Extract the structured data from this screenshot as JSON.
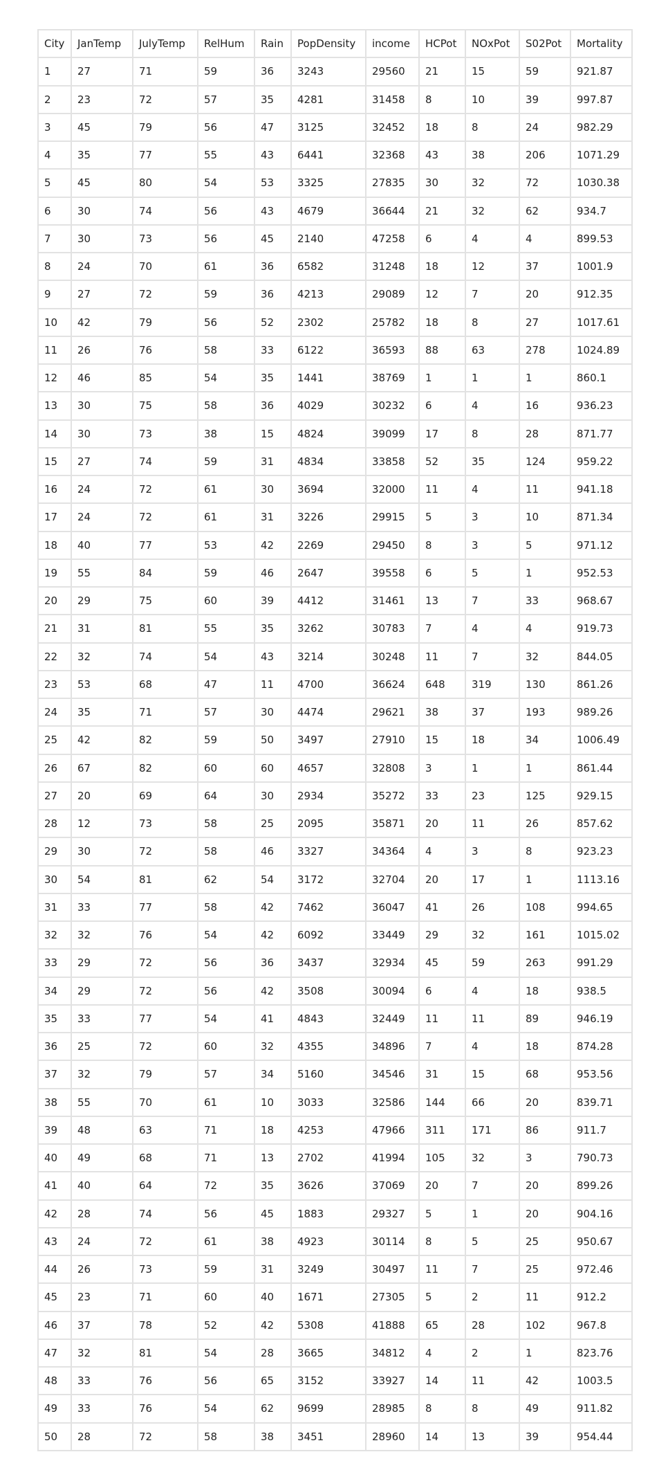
{
  "table": {
    "columns": [
      "City",
      "JanTemp",
      "JulyTemp",
      "RelHum",
      "Rain",
      "PopDensity",
      "income",
      "HCPot",
      "NOxPot",
      "S02Pot",
      "Mortality"
    ],
    "rows": [
      [
        "1",
        "27",
        "71",
        "59",
        "36",
        "3243",
        "29560",
        "21",
        "15",
        "59",
        "921.87"
      ],
      [
        "2",
        "23",
        "72",
        "57",
        "35",
        "4281",
        "31458",
        "8",
        "10",
        "39",
        "997.87"
      ],
      [
        "3",
        "45",
        "79",
        "56",
        "47",
        "3125",
        "32452",
        "18",
        "8",
        "24",
        "982.29"
      ],
      [
        "4",
        "35",
        "77",
        "55",
        "43",
        "6441",
        "32368",
        "43",
        "38",
        "206",
        "1071.29"
      ],
      [
        "5",
        "45",
        "80",
        "54",
        "53",
        "3325",
        "27835",
        "30",
        "32",
        "72",
        "1030.38"
      ],
      [
        "6",
        "30",
        "74",
        "56",
        "43",
        "4679",
        "36644",
        "21",
        "32",
        "62",
        "934.7"
      ],
      [
        "7",
        "30",
        "73",
        "56",
        "45",
        "2140",
        "47258",
        "6",
        "4",
        "4",
        "899.53"
      ],
      [
        "8",
        "24",
        "70",
        "61",
        "36",
        "6582",
        "31248",
        "18",
        "12",
        "37",
        "1001.9"
      ],
      [
        "9",
        "27",
        "72",
        "59",
        "36",
        "4213",
        "29089",
        "12",
        "7",
        "20",
        "912.35"
      ],
      [
        "10",
        "42",
        "79",
        "56",
        "52",
        "2302",
        "25782",
        "18",
        "8",
        "27",
        "1017.61"
      ],
      [
        "11",
        "26",
        "76",
        "58",
        "33",
        "6122",
        "36593",
        "88",
        "63",
        "278",
        "1024.89"
      ],
      [
        "12",
        "46",
        "85",
        "54",
        "35",
        "1441",
        "38769",
        "1",
        "1",
        "1",
        "860.1"
      ],
      [
        "13",
        "30",
        "75",
        "58",
        "36",
        "4029",
        "30232",
        "6",
        "4",
        "16",
        "936.23"
      ],
      [
        "14",
        "30",
        "73",
        "38",
        "15",
        "4824",
        "39099",
        "17",
        "8",
        "28",
        "871.77"
      ],
      [
        "15",
        "27",
        "74",
        "59",
        "31",
        "4834",
        "33858",
        "52",
        "35",
        "124",
        "959.22"
      ],
      [
        "16",
        "24",
        "72",
        "61",
        "30",
        "3694",
        "32000",
        "11",
        "4",
        "11",
        "941.18"
      ],
      [
        "17",
        "24",
        "72",
        "61",
        "31",
        "3226",
        "29915",
        "5",
        "3",
        "10",
        "871.34"
      ],
      [
        "18",
        "40",
        "77",
        "53",
        "42",
        "2269",
        "29450",
        "8",
        "3",
        "5",
        "971.12"
      ],
      [
        "19",
        "55",
        "84",
        "59",
        "46",
        "2647",
        "39558",
        "6",
        "5",
        "1",
        "952.53"
      ],
      [
        "20",
        "29",
        "75",
        "60",
        "39",
        "4412",
        "31461",
        "13",
        "7",
        "33",
        "968.67"
      ],
      [
        "21",
        "31",
        "81",
        "55",
        "35",
        "3262",
        "30783",
        "7",
        "4",
        "4",
        "919.73"
      ],
      [
        "22",
        "32",
        "74",
        "54",
        "43",
        "3214",
        "30248",
        "11",
        "7",
        "32",
        "844.05"
      ],
      [
        "23",
        "53",
        "68",
        "47",
        "11",
        "4700",
        "36624",
        "648",
        "319",
        "130",
        "861.26"
      ],
      [
        "24",
        "35",
        "71",
        "57",
        "30",
        "4474",
        "29621",
        "38",
        "37",
        "193",
        "989.26"
      ],
      [
        "25",
        "42",
        "82",
        "59",
        "50",
        "3497",
        "27910",
        "15",
        "18",
        "34",
        "1006.49"
      ],
      [
        "26",
        "67",
        "82",
        "60",
        "60",
        "4657",
        "32808",
        "3",
        "1",
        "1",
        "861.44"
      ],
      [
        "27",
        "20",
        "69",
        "64",
        "30",
        "2934",
        "35272",
        "33",
        "23",
        "125",
        "929.15"
      ],
      [
        "28",
        "12",
        "73",
        "58",
        "25",
        "2095",
        "35871",
        "20",
        "11",
        "26",
        "857.62"
      ],
      [
        "29",
        "30",
        "72",
        "58",
        "46",
        "3327",
        "34364",
        "4",
        "3",
        "8",
        "923.23"
      ],
      [
        "30",
        "54",
        "81",
        "62",
        "54",
        "3172",
        "32704",
        "20",
        "17",
        "1",
        "1113.16"
      ],
      [
        "31",
        "33",
        "77",
        "58",
        "42",
        "7462",
        "36047",
        "41",
        "26",
        "108",
        "994.65"
      ],
      [
        "32",
        "32",
        "76",
        "54",
        "42",
        "6092",
        "33449",
        "29",
        "32",
        "161",
        "1015.02"
      ],
      [
        "33",
        "29",
        "72",
        "56",
        "36",
        "3437",
        "32934",
        "45",
        "59",
        "263",
        "991.29"
      ],
      [
        "34",
        "29",
        "72",
        "56",
        "42",
        "3508",
        "30094",
        "6",
        "4",
        "18",
        "938.5"
      ],
      [
        "35",
        "33",
        "77",
        "54",
        "41",
        "4843",
        "32449",
        "11",
        "11",
        "89",
        "946.19"
      ],
      [
        "36",
        "25",
        "72",
        "60",
        "32",
        "4355",
        "34896",
        "7",
        "4",
        "18",
        "874.28"
      ],
      [
        "37",
        "32",
        "79",
        "57",
        "34",
        "5160",
        "34546",
        "31",
        "15",
        "68",
        "953.56"
      ],
      [
        "38",
        "55",
        "70",
        "61",
        "10",
        "3033",
        "32586",
        "144",
        "66",
        "20",
        "839.71"
      ],
      [
        "39",
        "48",
        "63",
        "71",
        "18",
        "4253",
        "47966",
        "311",
        "171",
        "86",
        "911.7"
      ],
      [
        "40",
        "49",
        "68",
        "71",
        "13",
        "2702",
        "41994",
        "105",
        "32",
        "3",
        "790.73"
      ],
      [
        "41",
        "40",
        "64",
        "72",
        "35",
        "3626",
        "37069",
        "20",
        "7",
        "20",
        "899.26"
      ],
      [
        "42",
        "28",
        "74",
        "56",
        "45",
        "1883",
        "29327",
        "5",
        "1",
        "20",
        "904.16"
      ],
      [
        "43",
        "24",
        "72",
        "61",
        "38",
        "4923",
        "30114",
        "8",
        "5",
        "25",
        "950.67"
      ],
      [
        "44",
        "26",
        "73",
        "59",
        "31",
        "3249",
        "30497",
        "11",
        "7",
        "25",
        "972.46"
      ],
      [
        "45",
        "23",
        "71",
        "60",
        "40",
        "1671",
        "27305",
        "5",
        "2",
        "11",
        "912.2"
      ],
      [
        "46",
        "37",
        "78",
        "52",
        "42",
        "5308",
        "41888",
        "65",
        "28",
        "102",
        "967.8"
      ],
      [
        "47",
        "32",
        "81",
        "54",
        "28",
        "3665",
        "34812",
        "4",
        "2",
        "1",
        "823.76"
      ],
      [
        "48",
        "33",
        "76",
        "56",
        "65",
        "3152",
        "33927",
        "14",
        "11",
        "42",
        "1003.5"
      ],
      [
        "49",
        "33",
        "76",
        "54",
        "62",
        "9699",
        "28985",
        "8",
        "8",
        "49",
        "911.82"
      ],
      [
        "50",
        "28",
        "72",
        "58",
        "38",
        "3451",
        "28960",
        "14",
        "13",
        "39",
        "954.44"
      ]
    ]
  },
  "colors": {
    "text": "#222222",
    "border": "#e2e2e2",
    "background": "#ffffff"
  }
}
